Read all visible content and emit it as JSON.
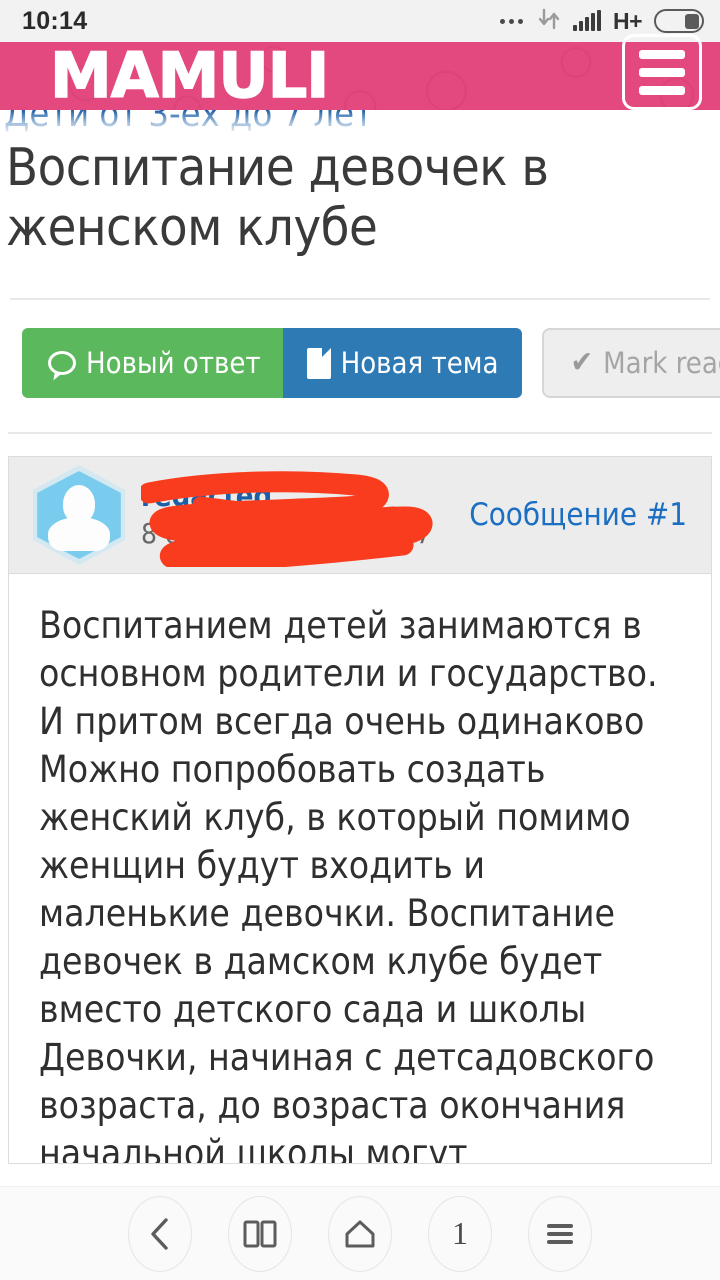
{
  "status_bar": {
    "time": "10:14",
    "network_type": "H+",
    "icons": [
      "more-dots-icon",
      "data-transfer-icon",
      "signal-bars-icon",
      "battery-icon"
    ]
  },
  "site_header": {
    "logo_text": "MAMULI",
    "brand_color": "#e3487e",
    "menu_label": "menu"
  },
  "breadcrumb": {
    "text": "Дети от 3-ех до 7 лет"
  },
  "page": {
    "title": "Воспитание девочек в женском клубе"
  },
  "toolbar": {
    "new_reply_label": "Новый ответ",
    "new_topic_label": "Новая тема",
    "mark_read_label": "Mark read",
    "green": "#5cb85c",
    "blue": "#2e7ab5"
  },
  "post": {
    "author": "redacted",
    "date": "8 октября 20.. в 17:17",
    "number_label": "Сообщение #1",
    "link_color": "#1b6ec2",
    "redaction_color": "#fa3c1e",
    "body": "Воспитанием детей занимаются в основном родители и государство. И притом всегда очень одинаково Можно попробовать создать женский клуб, в который помимо женщин будут входить и маленькие девочки. Воспитание девочек в дамском клубе будет вместо детского сада и школы Девочки, начиная с детсадовского возраста, до возраста окончания начальной школы могут воспитываться не в обычных детских садах и школах, а в"
  },
  "bottom_nav": {
    "back_label": "back",
    "bookmarks_label": "bookmarks",
    "home_label": "home",
    "tabs_count": "1",
    "menu_label": "menu"
  }
}
